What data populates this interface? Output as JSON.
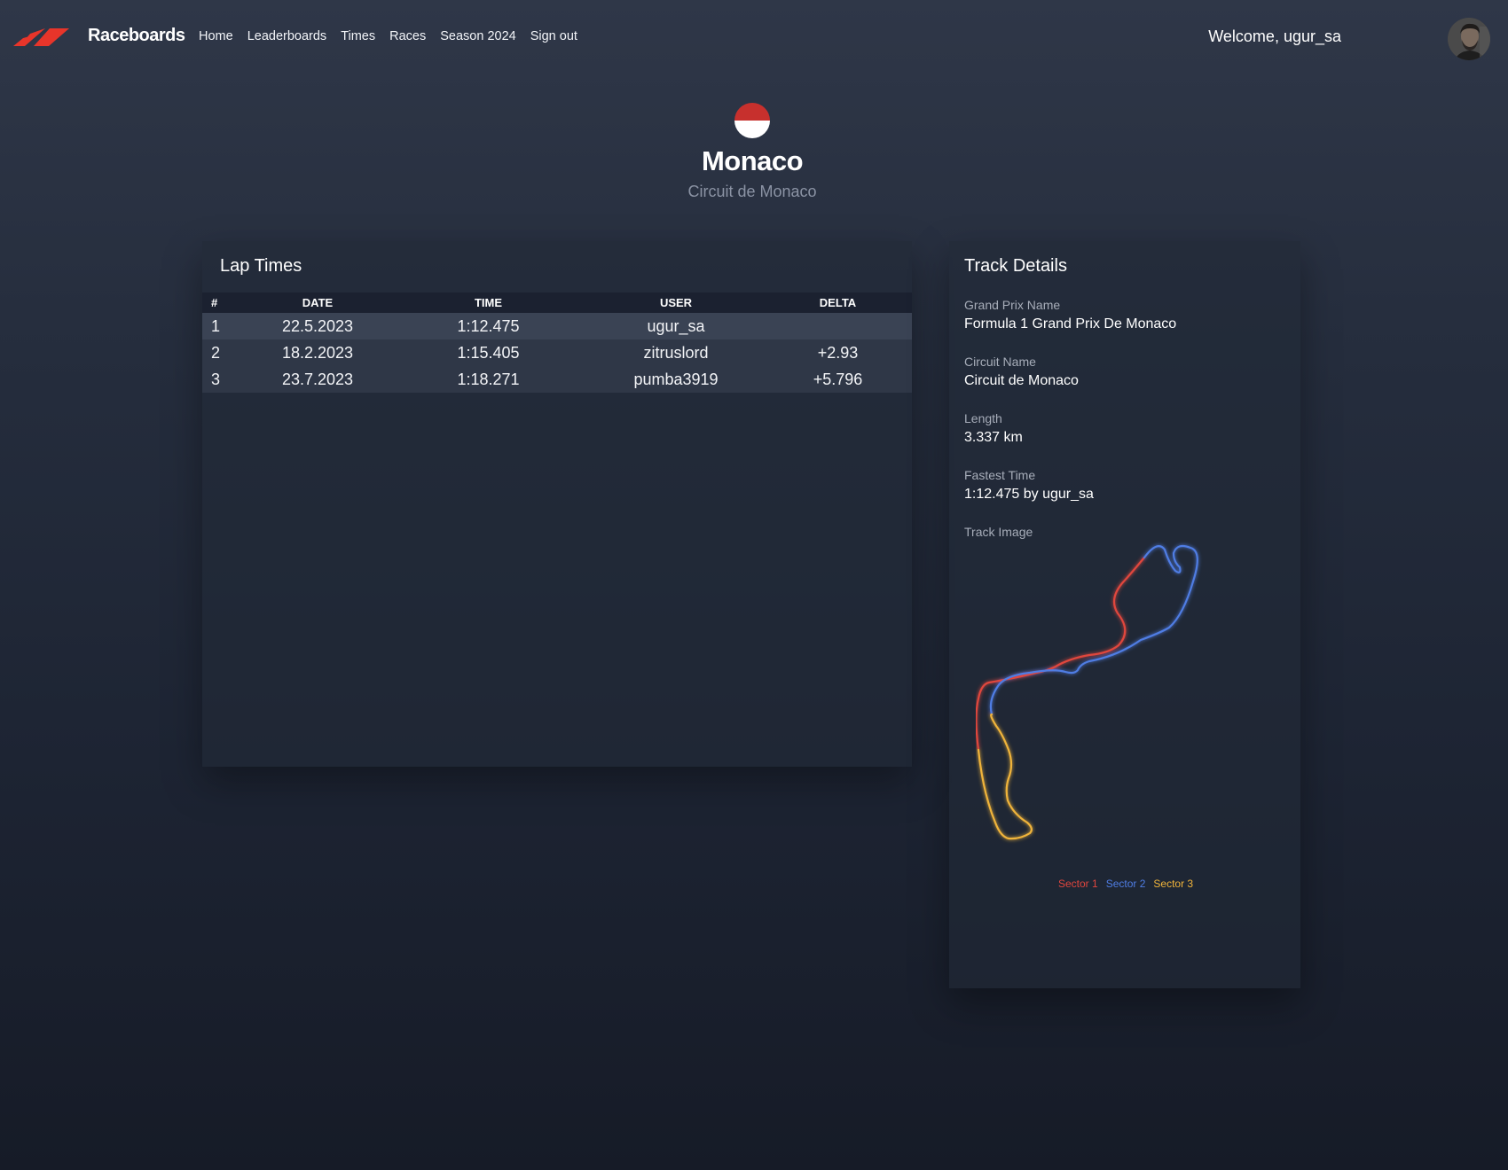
{
  "nav": {
    "brand": "Raceboards",
    "links": [
      "Home",
      "Leaderboards",
      "Times",
      "Races",
      "Season 2024",
      "Sign out"
    ],
    "welcome": "Welcome, ugur_sa"
  },
  "hero": {
    "country": "Monaco",
    "circuit": "Circuit de Monaco"
  },
  "lap_times": {
    "title": "Lap Times",
    "columns": [
      "#",
      "DATE",
      "TIME",
      "USER",
      "DELTA"
    ],
    "rows": [
      {
        "pos": "1",
        "date": "22.5.2023",
        "time": "1:12.475",
        "user": "ugur_sa",
        "delta": ""
      },
      {
        "pos": "2",
        "date": "18.2.2023",
        "time": "1:15.405",
        "user": "zitruslord",
        "delta": "+2.93"
      },
      {
        "pos": "3",
        "date": "23.7.2023",
        "time": "1:18.271",
        "user": "pumba3919",
        "delta": "+5.796"
      }
    ]
  },
  "track_details": {
    "title": "Track Details",
    "grand_prix_label": "Grand Prix Name",
    "grand_prix_value": "Formula 1 Grand Prix De Monaco",
    "circuit_label": "Circuit Name",
    "circuit_value": "Circuit de Monaco",
    "length_label": "Length",
    "length_value": "3.337 km",
    "fastest_label": "Fastest Time",
    "fastest_value": "1:12.475 by ugur_sa",
    "image_label": "Track Image",
    "sectors": [
      {
        "label": "Sector 1",
        "color": "#e0463e"
      },
      {
        "label": "Sector 2",
        "color": "#4f7de4"
      },
      {
        "label": "Sector 3",
        "color": "#f0b43a"
      }
    ]
  },
  "colors": {
    "brand_red": "#e8352a",
    "row_highlight": "#3a4354",
    "row": "#2f3747",
    "header_row": "#1b2130"
  }
}
